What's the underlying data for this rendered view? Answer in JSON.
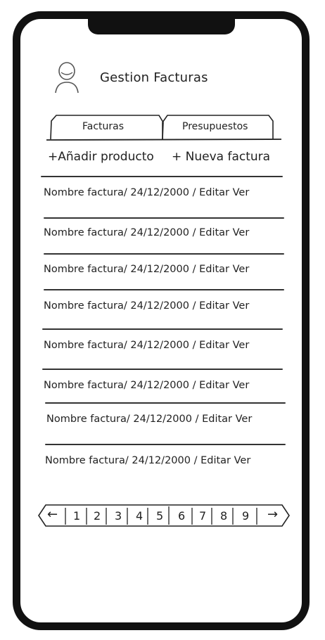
{
  "header": {
    "title": "Gestion Facturas",
    "avatar_icon": "user-avatar-icon"
  },
  "tabs": [
    {
      "label": "Facturas",
      "active": true
    },
    {
      "label": "Presupuestos",
      "active": false
    }
  ],
  "toolbar": {
    "add_product": "+Añadir producto",
    "new_invoice": "+ Nueva factura"
  },
  "invoices": [
    {
      "name": "Nombre factura",
      "date": "/ 24/12/2000",
      "edit": "/ Editar",
      "view": "Ver"
    },
    {
      "name": "Nombre factura",
      "date": "/ 24/12/2000",
      "edit": "/ Editar",
      "view": "Ver"
    },
    {
      "name": "Nombre factura",
      "date": "/ 24/12/2000",
      "edit": "/ Editar",
      "view": "Ver"
    },
    {
      "name": "Nombre factura",
      "date": "/ 24/12/2000",
      "edit": "/ Editar",
      "view": "Ver"
    },
    {
      "name": "Nombre factura",
      "date": "/ 24/12/2000",
      "edit": "/ Editar",
      "view": "Ver"
    },
    {
      "name": "Nombre factura",
      "date": "/ 24/12/2000",
      "edit": "/ Editar",
      "view": "Ver"
    },
    {
      "name": "Nombre factura",
      "date": "/ 24/12/2000",
      "edit": "/ Editar",
      "view": "Ver"
    },
    {
      "name": "Nombre factura",
      "date": "/ 24/12/2000",
      "edit": "/ Editar",
      "view": "Ver"
    }
  ],
  "pagination": {
    "prev": "←",
    "pages": [
      "1",
      "2",
      "3",
      "4",
      "5",
      "6",
      "7",
      "8",
      "9"
    ],
    "next": "→"
  }
}
